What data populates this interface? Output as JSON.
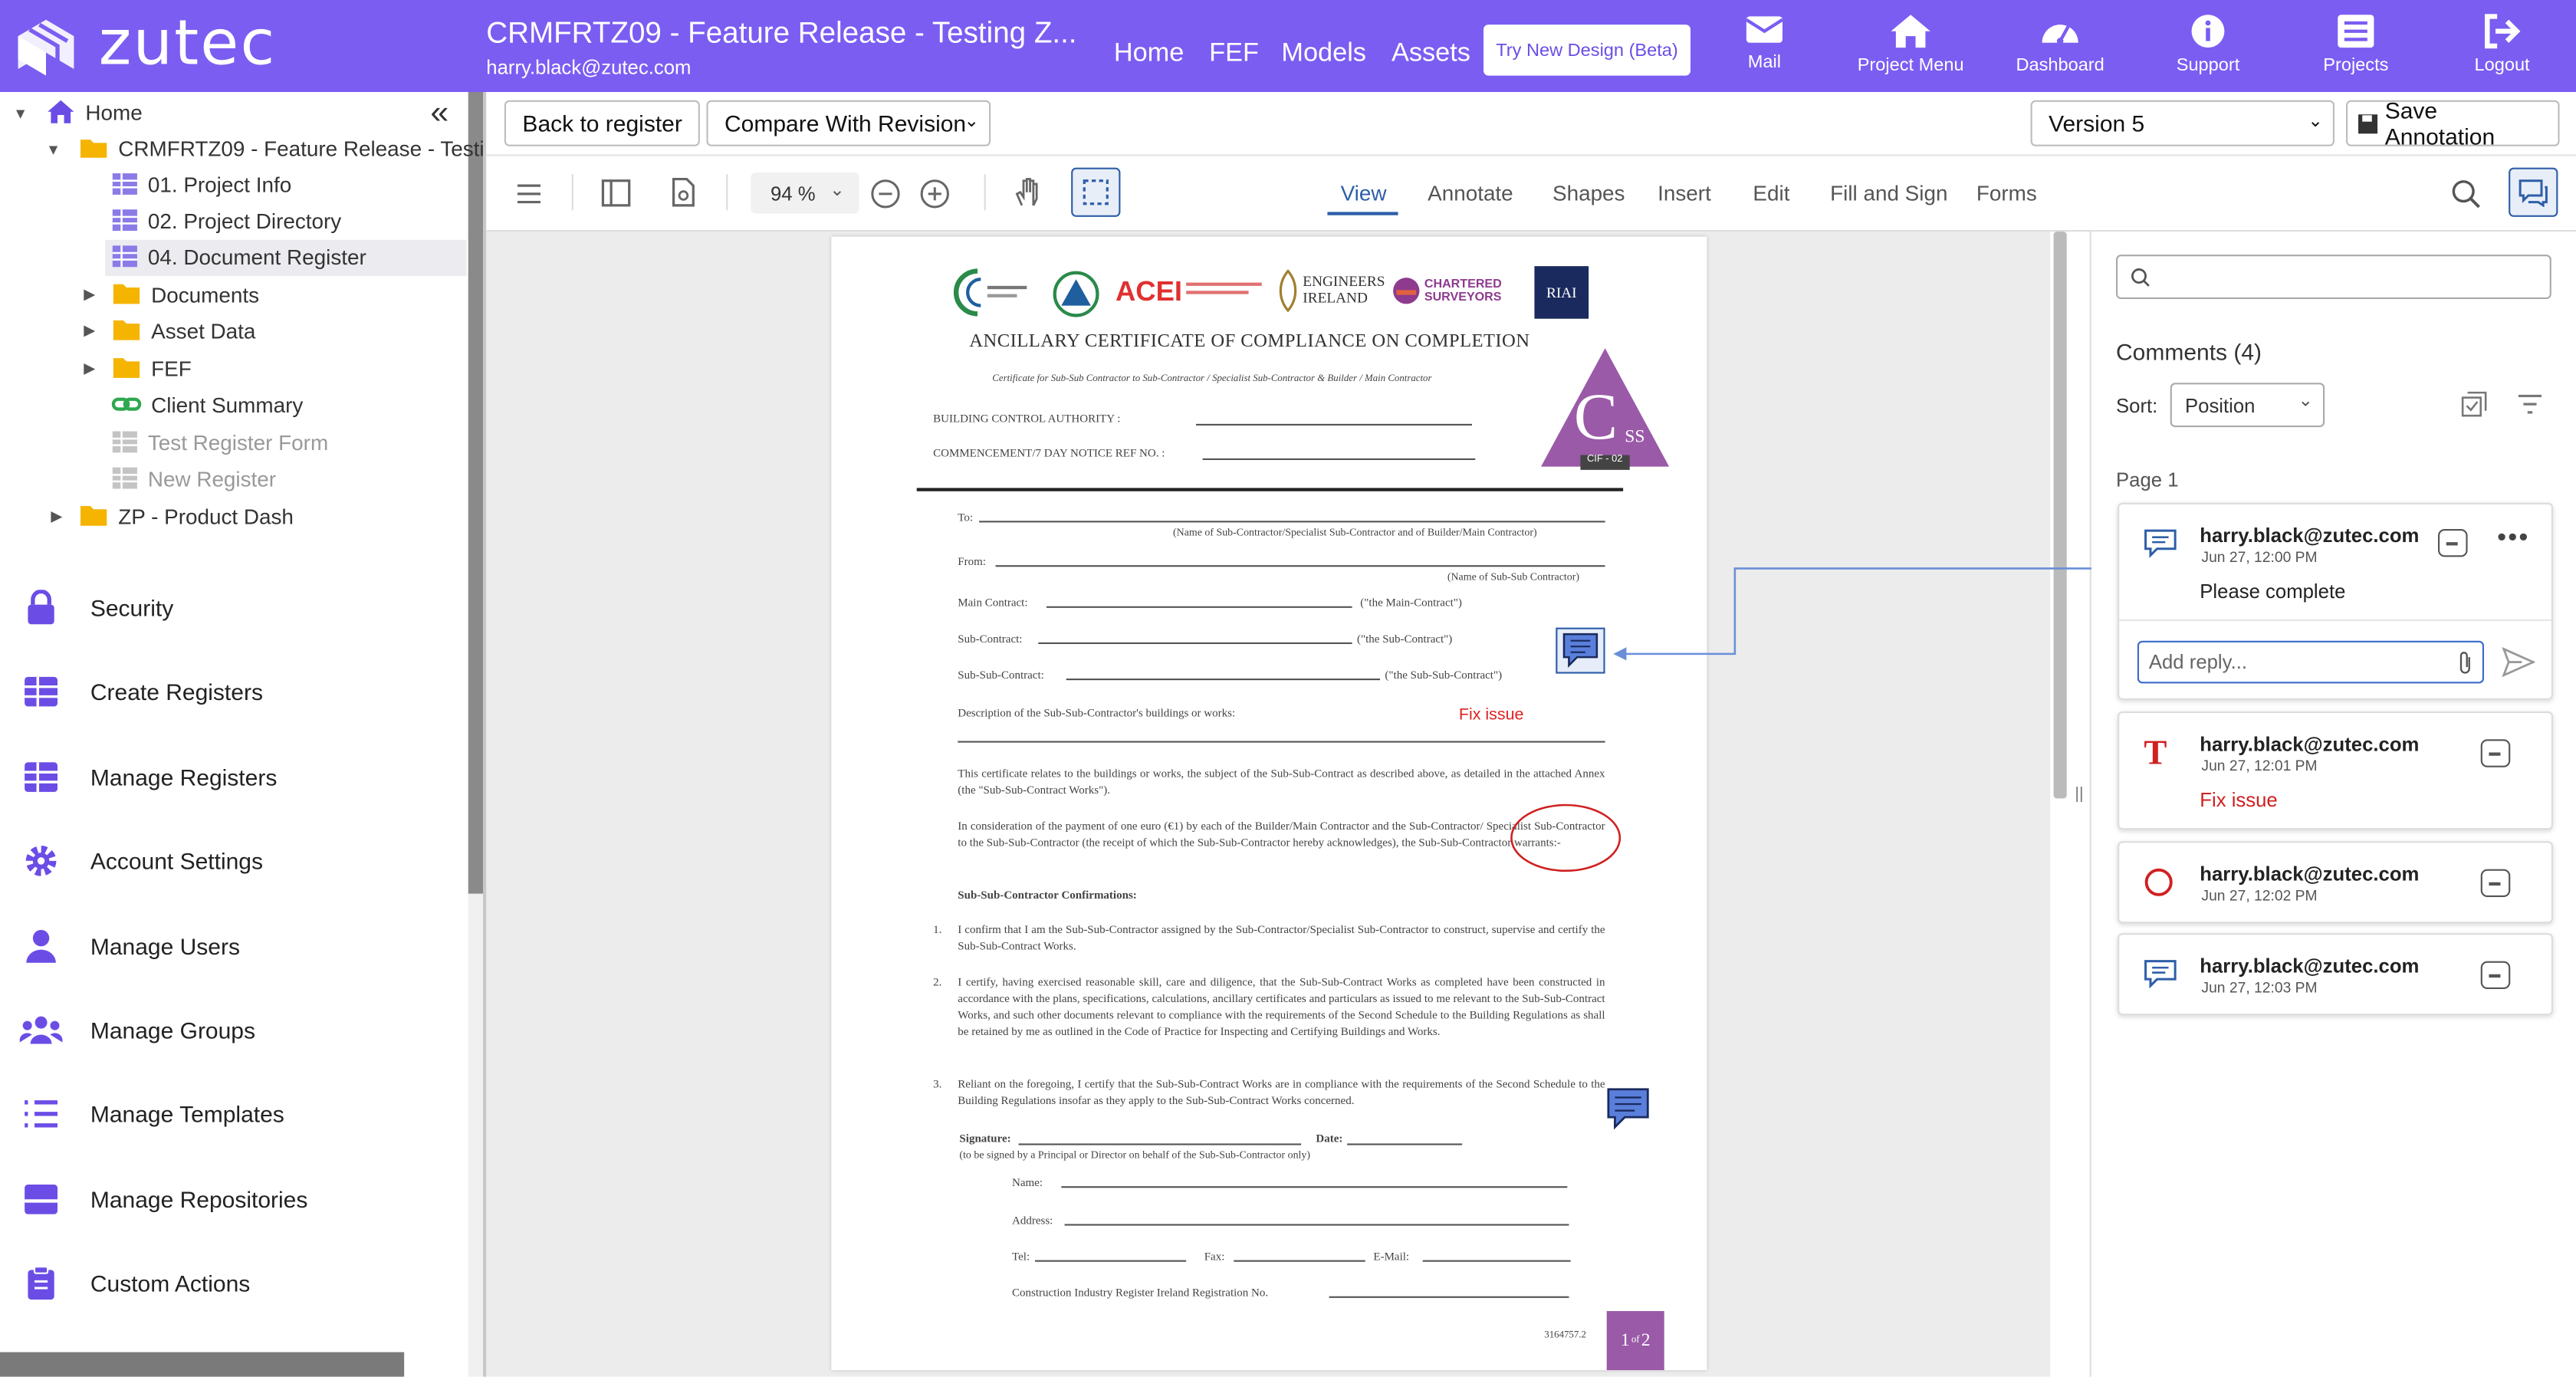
{
  "brand": {
    "name": "zutec",
    "bar_color": "#7b5df2"
  },
  "header": {
    "project_title": "CRMFRTZ09 - Feature Release - Testing Z...",
    "user_email": "harry.black@zutec.com",
    "links": [
      "Home",
      "FEF",
      "Models",
      "Assets"
    ],
    "beta_button": "Try New Design (Beta)",
    "icons": [
      {
        "label": "Mail",
        "icon": "mail-icon"
      },
      {
        "label": "Project Menu",
        "icon": "home-icon"
      },
      {
        "label": "Dashboard",
        "icon": "dashboard-icon"
      },
      {
        "label": "Support",
        "icon": "info-icon"
      },
      {
        "label": "Projects",
        "icon": "list-icon"
      },
      {
        "label": "Logout",
        "icon": "logout-icon"
      }
    ]
  },
  "tree": {
    "home": "Home",
    "project": "CRMFRTZ09 - Feature Release - Testi",
    "items": [
      {
        "label": "01. Project Info",
        "icon": "register-icon"
      },
      {
        "label": "02. Project Directory",
        "icon": "register-icon"
      },
      {
        "label": "04. Document Register",
        "icon": "register-icon"
      },
      {
        "label": "Documents",
        "icon": "folder-icon"
      },
      {
        "label": "Asset Data",
        "icon": "folder-icon"
      },
      {
        "label": "FEF",
        "icon": "folder-icon"
      },
      {
        "label": "Client Summary",
        "icon": "link-icon"
      },
      {
        "label": "Test Register Form",
        "icon": "register-grey-icon"
      },
      {
        "label": "New Register",
        "icon": "register-grey-icon"
      }
    ],
    "zp": "ZP - Product Dash"
  },
  "menu": [
    {
      "label": "Security",
      "icon": "lock-icon"
    },
    {
      "label": "Create Registers",
      "icon": "grid-icon"
    },
    {
      "label": "Manage Registers",
      "icon": "grid-icon"
    },
    {
      "label": "Account Settings",
      "icon": "gear-icon"
    },
    {
      "label": "Manage Users",
      "icon": "user-icon"
    },
    {
      "label": "Manage Groups",
      "icon": "users-icon"
    },
    {
      "label": "Manage Templates",
      "icon": "list-icon"
    },
    {
      "label": "Manage Repositories",
      "icon": "repository-icon"
    },
    {
      "label": "Custom Actions",
      "icon": "clipboard-icon"
    }
  ],
  "toolbar": {
    "back": "Back to register",
    "compare": "Compare With Revision",
    "version": "Version 5",
    "save": "Save Annotation"
  },
  "viewer": {
    "zoom": "94 %",
    "tabs": [
      "View",
      "Annotate",
      "Shapes",
      "Insert",
      "Edit",
      "Fill and Sign",
      "Forms"
    ],
    "active_tab": "View",
    "accent": "#2e5ea8"
  },
  "document": {
    "logos": [
      "ACEI",
      "ENGINEERS IRELAND",
      "CHARTERED SURVEYORS",
      "RIAI"
    ],
    "title": "ANCILLARY CERTIFICATE OF COMPLIANCE ON COMPLETION",
    "subtitle": "Certificate for Sub-Sub Contractor to Sub-Contractor / Specialist Sub-Contractor & Builder / Main Contractor",
    "badge_letters": "C",
    "badge_small": "SS",
    "badge_code": "CIF - 02",
    "bca": "BUILDING CONTROL AUTHORITY :",
    "commencement": "COMMENCEMENT/7 DAY NOTICE REF NO. :",
    "to": "To:",
    "to_note": "(Name of Sub-Contractor/Specialist Sub-Contractor and of Builder/Main Contractor)",
    "from": "From:",
    "from_note": "(Name of Sub-Sub Contractor)",
    "main_contract": "Main Contract:",
    "main_contract_note": "(\"the Main-Contract\")",
    "sub_contract": "Sub-Contract:",
    "sub_contract_note": "(\"the Sub-Contract\")",
    "sub_sub_contract": "Sub-Sub-Contract:",
    "sub_sub_contract_note": "(\"the Sub-Sub-Contract\")",
    "description": "Description of the Sub-Sub-Contractor's buildings or works:",
    "fix_issue": "Fix issue",
    "para1": "This certificate relates to the buildings or works, the subject of the Sub-Sub-Contract as described above, as detailed in the attached Annex (the \"Sub-Sub-Contract Works\").",
    "para2": "In consideration of the payment of one euro (€1) by each of the Builder/Main Contractor and the Sub-Contractor/ Specialist Sub-Contractor to the Sub-Sub-Contractor (the receipt of which the Sub-Sub-Contractor hereby acknowledges), the Sub-Sub-Contractor warrants:-",
    "confirmations": "Sub-Sub-Contractor Confirmations:",
    "item1": "I confirm that I am the Sub-Sub-Contractor assigned by the Sub-Contractor/Specialist Sub-Contractor to construct, supervise and certify the Sub-Sub-Contract Works.",
    "item2": "I certify, having exercised reasonable skill, care and diligence, that the Sub-Sub-Contract Works as completed have been constructed in accordance with the plans, specifications, calculations, ancillary certificates and particulars as issued to me relevant to the Sub-Sub-Contract Works, and such other documents relevant to compliance with the requirements of the Second Schedule to the Building Regulations as shall be retained by me as outlined in the Code of Practice for Inspecting and Certifying Buildings and Works.",
    "item3": "Reliant on the foregoing, I certify that the Sub-Sub-Contract Works are in compliance with the requirements of the Second Schedule to the Building Regulations insofar as they apply to the Sub-Sub-Contract Works concerned.",
    "signature": "Signature:",
    "date": "Date:",
    "signed_note": "(to be signed by a Principal or Director on behalf of the Sub-Sub-Contractor only)",
    "name": "Name:",
    "address": "Address:",
    "tel": "Tel:",
    "fax": "Fax:",
    "email": "E-Mail:",
    "cirl": "Construction Industry Register Ireland Registration No.",
    "doc_no": "3164757.2",
    "page_main": "1",
    "page_of": "of",
    "page_total": "2"
  },
  "comments": {
    "title": "Comments (4)",
    "sort_label": "Sort:",
    "sort_value": "Position",
    "page_label": "Page 1",
    "reply_placeholder": "Add reply...",
    "items": [
      {
        "author": "harry.black@zutec.com",
        "date": "Jun 27, 12:00 PM",
        "text": "Please complete",
        "icon": "comment-icon"
      },
      {
        "author": "harry.black@zutec.com",
        "date": "Jun 27, 12:01 PM",
        "text": "Fix issue",
        "icon": "text-icon"
      },
      {
        "author": "harry.black@zutec.com",
        "date": "Jun 27, 12:02 PM",
        "text": "",
        "icon": "circle-icon"
      },
      {
        "author": "harry.black@zutec.com",
        "date": "Jun 27, 12:03 PM",
        "text": "",
        "icon": "comment-icon"
      }
    ]
  }
}
